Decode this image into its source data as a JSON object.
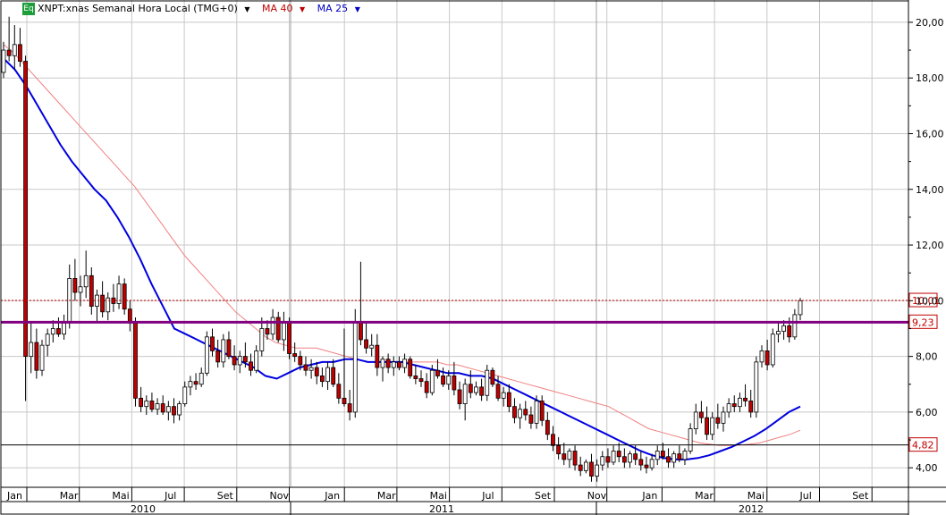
{
  "header": {
    "badge": "Eq",
    "title": "XNPT:xnas Semanal Hora Local (TMG+0)",
    "ma40_label": "MA 40",
    "ma25_label": "MA 25"
  },
  "colors": {
    "up": "#ffffff",
    "down": "#c00000",
    "wick": "#000000",
    "ma25": "#0000e0",
    "ma40": "#f08080",
    "resistance": "#800080",
    "last_price": "#c00000",
    "grid": "#c8c8c8",
    "badge": "#1e9e3a"
  },
  "chart_data": {
    "type": "candlestick",
    "ylim": [
      3.3,
      20.8
    ],
    "y_ticks": [
      "4,00",
      "6,00",
      "8,00",
      "10,00",
      "12,00",
      "14,00",
      "16,00",
      "18,00",
      "20,00"
    ],
    "y_tick_values": [
      4,
      6,
      8,
      10,
      12,
      14,
      16,
      18,
      20
    ],
    "x_months": [
      "Jan",
      "Mar",
      "Mai",
      "Jul",
      "Set",
      "Nov",
      "Jan",
      "Mar",
      "Mai",
      "Jul",
      "Set",
      "Nov",
      "Jan",
      "Mar",
      "Mai",
      "Jul",
      "Set"
    ],
    "years": [
      "2010",
      "2011",
      "2012"
    ],
    "price_labels": [
      {
        "value": 10.01,
        "text": "10,01",
        "style": "dotted"
      },
      {
        "value": 9.23,
        "text": "9,23",
        "style": "resistance"
      },
      {
        "value": 4.82,
        "text": "4,82",
        "style": "line"
      }
    ],
    "series": [
      {
        "name": "MA 40",
        "values": [
          19.2,
          18.9,
          18.5,
          18.1,
          17.7,
          17.3,
          16.9,
          16.5,
          16.1,
          15.7,
          15.3,
          14.9,
          14.5,
          14.1,
          13.6,
          13.1,
          12.6,
          12.1,
          11.6,
          11.2,
          10.8,
          10.4,
          10.0,
          9.6,
          9.3,
          9.0,
          8.7,
          8.5,
          8.4,
          8.3,
          8.3,
          8.3,
          8.2,
          8.1,
          8.0,
          7.9,
          7.8,
          7.8,
          7.8,
          7.8,
          7.8,
          7.8,
          7.8,
          7.8,
          7.7,
          7.7,
          7.6,
          7.5,
          7.4,
          7.3,
          7.2,
          7.1,
          7.0,
          6.9,
          6.8,
          6.7,
          6.6,
          6.5,
          6.4,
          6.3,
          6.2,
          6.0,
          5.8,
          5.6,
          5.4,
          5.3,
          5.2,
          5.1,
          5.0,
          4.9,
          4.85,
          4.8,
          4.8,
          4.82,
          4.85,
          4.9,
          5.0,
          5.1,
          5.2,
          5.35
        ]
      },
      {
        "name": "MA 25",
        "values": [
          18.7,
          18.3,
          17.7,
          17.0,
          16.3,
          15.6,
          15.0,
          14.5,
          14.0,
          13.6,
          13.0,
          12.3,
          11.5,
          10.6,
          9.8,
          9.0,
          8.8,
          8.6,
          8.4,
          8.2,
          8.0,
          7.8,
          7.6,
          7.3,
          7.2,
          7.4,
          7.6,
          7.7,
          7.8,
          7.8,
          7.9,
          7.9,
          7.8,
          7.8,
          7.8,
          7.8,
          7.7,
          7.6,
          7.5,
          7.4,
          7.4,
          7.3,
          7.3,
          7.2,
          7.0,
          6.8,
          6.6,
          6.4,
          6.2,
          6.0,
          5.8,
          5.6,
          5.4,
          5.2,
          5.0,
          4.8,
          4.6,
          4.45,
          4.35,
          4.3,
          4.3,
          4.35,
          4.45,
          4.6,
          4.75,
          4.95,
          5.15,
          5.4,
          5.7,
          6.0,
          6.2
        ]
      }
    ],
    "candles": [
      {
        "o": 18.2,
        "h": 19.3,
        "l": 18.0,
        "c": 19.0
      },
      {
        "o": 19.0,
        "h": 20.2,
        "l": 18.6,
        "c": 18.8
      },
      {
        "o": 18.8,
        "h": 19.9,
        "l": 18.3,
        "c": 19.2
      },
      {
        "o": 19.2,
        "h": 19.8,
        "l": 18.4,
        "c": 18.6
      },
      {
        "o": 18.6,
        "h": 18.8,
        "l": 6.4,
        "c": 8.0
      },
      {
        "o": 8.0,
        "h": 9.2,
        "l": 7.4,
        "c": 8.5
      },
      {
        "o": 8.5,
        "h": 9.0,
        "l": 7.2,
        "c": 7.5
      },
      {
        "o": 7.5,
        "h": 8.6,
        "l": 7.3,
        "c": 8.4
      },
      {
        "o": 8.4,
        "h": 9.0,
        "l": 8.0,
        "c": 8.8
      },
      {
        "o": 8.8,
        "h": 9.3,
        "l": 8.5,
        "c": 9.0
      },
      {
        "o": 9.0,
        "h": 9.4,
        "l": 8.7,
        "c": 8.8
      },
      {
        "o": 8.8,
        "h": 9.5,
        "l": 8.6,
        "c": 9.2
      },
      {
        "o": 9.2,
        "h": 11.3,
        "l": 9.0,
        "c": 10.8
      },
      {
        "o": 10.8,
        "h": 11.5,
        "l": 10.0,
        "c": 10.3
      },
      {
        "o": 10.3,
        "h": 10.9,
        "l": 9.8,
        "c": 10.5
      },
      {
        "o": 10.5,
        "h": 11.8,
        "l": 10.1,
        "c": 10.9
      },
      {
        "o": 10.9,
        "h": 11.2,
        "l": 9.5,
        "c": 9.8
      },
      {
        "o": 9.8,
        "h": 10.4,
        "l": 9.2,
        "c": 10.2
      },
      {
        "o": 10.2,
        "h": 10.7,
        "l": 9.4,
        "c": 9.6
      },
      {
        "o": 9.6,
        "h": 10.3,
        "l": 9.3,
        "c": 10.1
      },
      {
        "o": 10.1,
        "h": 10.6,
        "l": 9.6,
        "c": 9.9
      },
      {
        "o": 9.9,
        "h": 10.9,
        "l": 9.7,
        "c": 10.6
      },
      {
        "o": 10.6,
        "h": 10.8,
        "l": 9.5,
        "c": 9.7
      },
      {
        "o": 9.7,
        "h": 10.0,
        "l": 8.9,
        "c": 9.2
      },
      {
        "o": 9.2,
        "h": 9.4,
        "l": 6.2,
        "c": 6.5
      },
      {
        "o": 6.5,
        "h": 6.9,
        "l": 6.0,
        "c": 6.2
      },
      {
        "o": 6.2,
        "h": 6.6,
        "l": 5.9,
        "c": 6.4
      },
      {
        "o": 6.4,
        "h": 6.7,
        "l": 6.0,
        "c": 6.1
      },
      {
        "o": 6.1,
        "h": 6.5,
        "l": 5.9,
        "c": 6.3
      },
      {
        "o": 6.3,
        "h": 6.6,
        "l": 5.9,
        "c": 6.0
      },
      {
        "o": 6.0,
        "h": 6.4,
        "l": 5.7,
        "c": 6.2
      },
      {
        "o": 6.2,
        "h": 6.5,
        "l": 5.6,
        "c": 5.9
      },
      {
        "o": 5.9,
        "h": 6.4,
        "l": 5.7,
        "c": 6.3
      },
      {
        "o": 6.3,
        "h": 7.1,
        "l": 6.2,
        "c": 6.9
      },
      {
        "o": 6.9,
        "h": 7.3,
        "l": 6.6,
        "c": 7.1
      },
      {
        "o": 7.1,
        "h": 7.4,
        "l": 6.8,
        "c": 7.0
      },
      {
        "o": 7.0,
        "h": 7.6,
        "l": 6.9,
        "c": 7.4
      },
      {
        "o": 7.4,
        "h": 8.9,
        "l": 7.3,
        "c": 8.7
      },
      {
        "o": 8.7,
        "h": 9.0,
        "l": 8.0,
        "c": 8.2
      },
      {
        "o": 8.2,
        "h": 8.6,
        "l": 7.6,
        "c": 7.8
      },
      {
        "o": 7.8,
        "h": 8.8,
        "l": 7.6,
        "c": 8.6
      },
      {
        "o": 8.6,
        "h": 8.9,
        "l": 7.9,
        "c": 8.0
      },
      {
        "o": 8.0,
        "h": 8.4,
        "l": 7.5,
        "c": 7.7
      },
      {
        "o": 7.7,
        "h": 8.2,
        "l": 7.4,
        "c": 8.0
      },
      {
        "o": 8.0,
        "h": 8.5,
        "l": 7.6,
        "c": 7.8
      },
      {
        "o": 7.8,
        "h": 8.1,
        "l": 7.3,
        "c": 7.5
      },
      {
        "o": 7.5,
        "h": 8.4,
        "l": 7.4,
        "c": 8.2
      },
      {
        "o": 8.2,
        "h": 9.4,
        "l": 8.0,
        "c": 9.0
      },
      {
        "o": 9.0,
        "h": 9.3,
        "l": 8.6,
        "c": 8.8
      },
      {
        "o": 8.8,
        "h": 9.7,
        "l": 8.6,
        "c": 9.4
      },
      {
        "o": 9.4,
        "h": 9.6,
        "l": 8.5,
        "c": 8.6
      },
      {
        "o": 8.6,
        "h": 9.6,
        "l": 8.2,
        "c": 9.2
      },
      {
        "o": 9.2,
        "h": 9.4,
        "l": 7.9,
        "c": 8.1
      },
      {
        "o": 8.1,
        "h": 8.5,
        "l": 7.8,
        "c": 8.0
      },
      {
        "o": 8.0,
        "h": 8.2,
        "l": 7.5,
        "c": 7.7
      },
      {
        "o": 7.7,
        "h": 8.0,
        "l": 7.3,
        "c": 7.5
      },
      {
        "o": 7.5,
        "h": 7.9,
        "l": 7.2,
        "c": 7.6
      },
      {
        "o": 7.6,
        "h": 7.8,
        "l": 7.0,
        "c": 7.3
      },
      {
        "o": 7.3,
        "h": 7.6,
        "l": 6.9,
        "c": 7.1
      },
      {
        "o": 7.1,
        "h": 7.8,
        "l": 6.8,
        "c": 7.6
      },
      {
        "o": 7.6,
        "h": 7.9,
        "l": 6.9,
        "c": 7.0
      },
      {
        "o": 7.0,
        "h": 7.4,
        "l": 6.3,
        "c": 6.5
      },
      {
        "o": 6.5,
        "h": 9.0,
        "l": 6.2,
        "c": 6.3
      },
      {
        "o": 6.3,
        "h": 6.8,
        "l": 5.7,
        "c": 6.0
      },
      {
        "o": 6.0,
        "h": 9.7,
        "l": 5.8,
        "c": 9.2
      },
      {
        "o": 9.2,
        "h": 11.4,
        "l": 8.4,
        "c": 8.6
      },
      {
        "o": 8.6,
        "h": 9.2,
        "l": 8.1,
        "c": 8.3
      },
      {
        "o": 8.3,
        "h": 8.8,
        "l": 8.0,
        "c": 8.4
      },
      {
        "o": 8.4,
        "h": 8.8,
        "l": 7.3,
        "c": 7.6
      },
      {
        "o": 7.6,
        "h": 8.0,
        "l": 7.1,
        "c": 7.9
      },
      {
        "o": 7.9,
        "h": 8.1,
        "l": 7.4,
        "c": 7.6
      },
      {
        "o": 7.6,
        "h": 8.0,
        "l": 7.3,
        "c": 7.8
      },
      {
        "o": 7.8,
        "h": 8.0,
        "l": 7.5,
        "c": 7.6
      },
      {
        "o": 7.6,
        "h": 8.1,
        "l": 7.4,
        "c": 7.9
      },
      {
        "o": 7.9,
        "h": 8.0,
        "l": 7.2,
        "c": 7.3
      },
      {
        "o": 7.3,
        "h": 7.7,
        "l": 7.0,
        "c": 7.2
      },
      {
        "o": 7.2,
        "h": 7.5,
        "l": 6.9,
        "c": 7.1
      },
      {
        "o": 7.1,
        "h": 7.4,
        "l": 6.5,
        "c": 6.7
      },
      {
        "o": 6.7,
        "h": 7.7,
        "l": 6.6,
        "c": 7.5
      },
      {
        "o": 7.5,
        "h": 7.9,
        "l": 7.2,
        "c": 7.3
      },
      {
        "o": 7.3,
        "h": 7.6,
        "l": 6.9,
        "c": 7.0
      },
      {
        "o": 7.0,
        "h": 7.5,
        "l": 6.8,
        "c": 7.3
      },
      {
        "o": 7.3,
        "h": 7.8,
        "l": 6.6,
        "c": 6.8
      },
      {
        "o": 6.8,
        "h": 7.1,
        "l": 6.1,
        "c": 6.3
      },
      {
        "o": 6.3,
        "h": 7.2,
        "l": 5.7,
        "c": 7.0
      },
      {
        "o": 7.0,
        "h": 7.5,
        "l": 6.5,
        "c": 6.7
      },
      {
        "o": 6.7,
        "h": 7.1,
        "l": 6.6,
        "c": 6.9
      },
      {
        "o": 6.9,
        "h": 7.2,
        "l": 6.4,
        "c": 6.6
      },
      {
        "o": 6.6,
        "h": 7.7,
        "l": 6.4,
        "c": 7.5
      },
      {
        "o": 7.5,
        "h": 7.6,
        "l": 6.9,
        "c": 7.0
      },
      {
        "o": 7.0,
        "h": 7.3,
        "l": 6.4,
        "c": 6.5
      },
      {
        "o": 6.5,
        "h": 6.9,
        "l": 6.2,
        "c": 6.7
      },
      {
        "o": 6.7,
        "h": 7.0,
        "l": 6.0,
        "c": 6.2
      },
      {
        "o": 6.2,
        "h": 6.5,
        "l": 5.6,
        "c": 5.8
      },
      {
        "o": 5.8,
        "h": 6.3,
        "l": 5.4,
        "c": 6.1
      },
      {
        "o": 6.1,
        "h": 6.4,
        "l": 5.7,
        "c": 5.9
      },
      {
        "o": 5.9,
        "h": 6.2,
        "l": 5.4,
        "c": 5.6
      },
      {
        "o": 5.6,
        "h": 6.6,
        "l": 5.4,
        "c": 6.4
      },
      {
        "o": 6.4,
        "h": 6.6,
        "l": 5.5,
        "c": 5.7
      },
      {
        "o": 5.7,
        "h": 6.0,
        "l": 5.0,
        "c": 5.2
      },
      {
        "o": 5.2,
        "h": 5.5,
        "l": 4.6,
        "c": 4.8
      },
      {
        "o": 4.8,
        "h": 5.1,
        "l": 4.3,
        "c": 4.5
      },
      {
        "o": 4.5,
        "h": 4.9,
        "l": 4.1,
        "c": 4.3
      },
      {
        "o": 4.3,
        "h": 4.7,
        "l": 4.0,
        "c": 4.6
      },
      {
        "o": 4.6,
        "h": 4.8,
        "l": 3.9,
        "c": 4.1
      },
      {
        "o": 4.1,
        "h": 4.4,
        "l": 3.7,
        "c": 3.9
      },
      {
        "o": 3.9,
        "h": 4.3,
        "l": 3.8,
        "c": 4.2
      },
      {
        "o": 4.2,
        "h": 4.5,
        "l": 3.5,
        "c": 3.7
      },
      {
        "o": 3.7,
        "h": 4.3,
        "l": 3.5,
        "c": 4.1
      },
      {
        "o": 4.1,
        "h": 4.6,
        "l": 3.9,
        "c": 4.4
      },
      {
        "o": 4.4,
        "h": 4.7,
        "l": 4.0,
        "c": 4.2
      },
      {
        "o": 4.2,
        "h": 4.8,
        "l": 4.1,
        "c": 4.6
      },
      {
        "o": 4.6,
        "h": 4.9,
        "l": 4.2,
        "c": 4.4
      },
      {
        "o": 4.4,
        "h": 4.7,
        "l": 4.0,
        "c": 4.2
      },
      {
        "o": 4.2,
        "h": 4.6,
        "l": 4.0,
        "c": 4.5
      },
      {
        "o": 4.5,
        "h": 4.8,
        "l": 4.1,
        "c": 4.3
      },
      {
        "o": 4.3,
        "h": 4.6,
        "l": 3.9,
        "c": 4.1
      },
      {
        "o": 4.1,
        "h": 4.4,
        "l": 3.8,
        "c": 4.0
      },
      {
        "o": 4.0,
        "h": 4.5,
        "l": 3.9,
        "c": 4.3
      },
      {
        "o": 4.3,
        "h": 4.8,
        "l": 4.1,
        "c": 4.6
      },
      {
        "o": 4.6,
        "h": 4.9,
        "l": 4.3,
        "c": 4.4
      },
      {
        "o": 4.4,
        "h": 4.7,
        "l": 4.0,
        "c": 4.2
      },
      {
        "o": 4.2,
        "h": 4.6,
        "l": 4.0,
        "c": 4.5
      },
      {
        "o": 4.5,
        "h": 4.8,
        "l": 4.2,
        "c": 4.3
      },
      {
        "o": 4.3,
        "h": 4.7,
        "l": 4.1,
        "c": 4.6
      },
      {
        "o": 4.6,
        "h": 5.6,
        "l": 4.5,
        "c": 5.4
      },
      {
        "o": 5.4,
        "h": 6.3,
        "l": 5.2,
        "c": 6.0
      },
      {
        "o": 6.0,
        "h": 6.4,
        "l": 5.6,
        "c": 5.8
      },
      {
        "o": 5.8,
        "h": 6.2,
        "l": 5.0,
        "c": 5.2
      },
      {
        "o": 5.2,
        "h": 6.0,
        "l": 5.0,
        "c": 5.8
      },
      {
        "o": 5.8,
        "h": 6.3,
        "l": 5.4,
        "c": 5.6
      },
      {
        "o": 5.6,
        "h": 6.2,
        "l": 5.3,
        "c": 6.0
      },
      {
        "o": 6.0,
        "h": 6.5,
        "l": 5.8,
        "c": 6.3
      },
      {
        "o": 6.3,
        "h": 6.6,
        "l": 6.0,
        "c": 6.2
      },
      {
        "o": 6.2,
        "h": 6.7,
        "l": 6.0,
        "c": 6.5
      },
      {
        "o": 6.5,
        "h": 7.0,
        "l": 6.2,
        "c": 6.4
      },
      {
        "o": 6.4,
        "h": 6.8,
        "l": 5.8,
        "c": 6.0
      },
      {
        "o": 6.0,
        "h": 8.0,
        "l": 5.8,
        "c": 7.8
      },
      {
        "o": 7.8,
        "h": 8.4,
        "l": 7.6,
        "c": 8.2
      },
      {
        "o": 8.2,
        "h": 8.6,
        "l": 7.5,
        "c": 7.7
      },
      {
        "o": 7.7,
        "h": 9.0,
        "l": 7.6,
        "c": 8.8
      },
      {
        "o": 8.8,
        "h": 9.2,
        "l": 8.5,
        "c": 8.9
      },
      {
        "o": 8.9,
        "h": 9.3,
        "l": 8.6,
        "c": 9.1
      },
      {
        "o": 9.1,
        "h": 9.4,
        "l": 8.5,
        "c": 8.7
      },
      {
        "o": 8.7,
        "h": 9.7,
        "l": 8.6,
        "c": 9.5
      },
      {
        "o": 9.5,
        "h": 10.1,
        "l": 9.3,
        "c": 10.0
      }
    ]
  }
}
